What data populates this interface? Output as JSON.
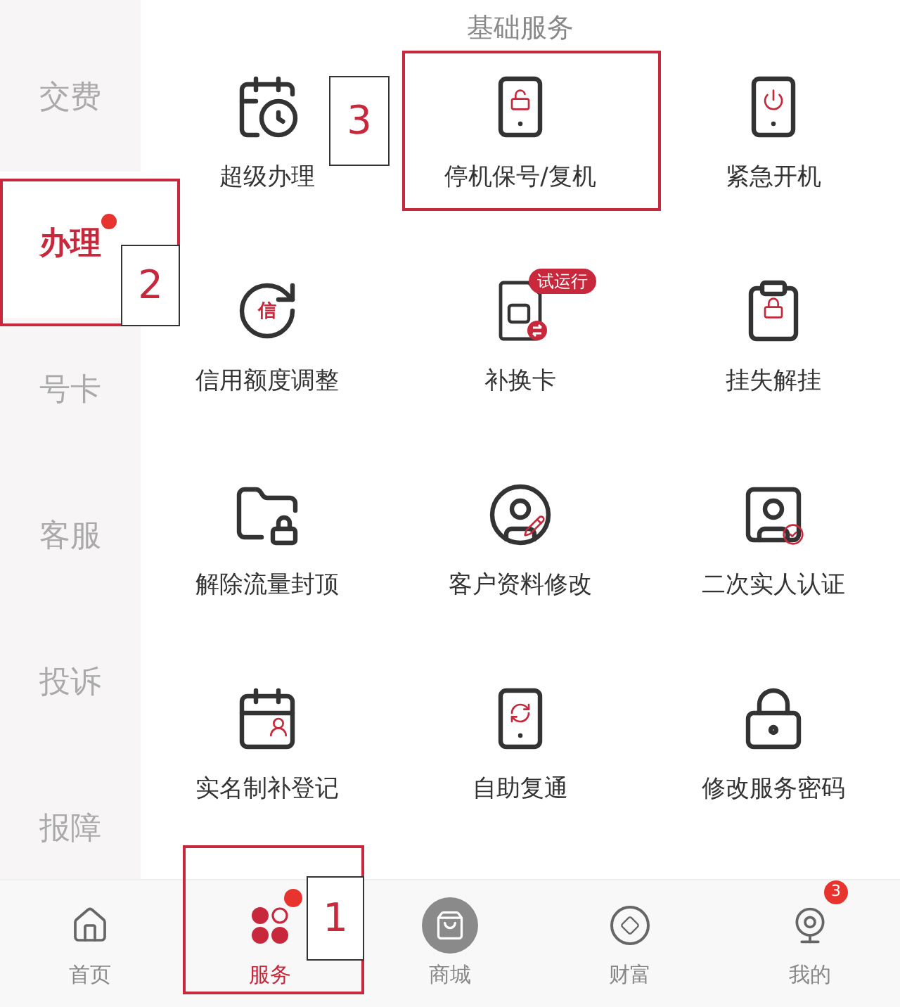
{
  "section_title": "基础服务",
  "sidebar": [
    {
      "label": "交费",
      "selected": false
    },
    {
      "label": "办理",
      "selected": true,
      "dot": true,
      "annotation": "2"
    },
    {
      "label": "号卡",
      "selected": false
    },
    {
      "label": "客服",
      "selected": false
    },
    {
      "label": "投诉",
      "selected": false
    },
    {
      "label": "报障",
      "selected": false
    }
  ],
  "services": [
    {
      "label": "超级办理"
    },
    {
      "label": "停机保号/复机",
      "annotation": "3"
    },
    {
      "label": "紧急开机"
    },
    {
      "label": "信用额度调整",
      "icon_text": "信"
    },
    {
      "label": "补换卡",
      "badge": "试运行"
    },
    {
      "label": "挂失解挂"
    },
    {
      "label": "解除流量封顶"
    },
    {
      "label": "客户资料修改"
    },
    {
      "label": "二次实人认证"
    },
    {
      "label": "实名制补登记"
    },
    {
      "label": "自助复通"
    },
    {
      "label": "修改服务密码"
    }
  ],
  "tabs": [
    {
      "label": "首页",
      "selected": false
    },
    {
      "label": "服务",
      "selected": true,
      "dot": true,
      "annotation": "1"
    },
    {
      "label": "商城",
      "selected": false
    },
    {
      "label": "财富",
      "selected": false
    },
    {
      "label": "我的",
      "selected": false,
      "badge": "3"
    }
  ]
}
